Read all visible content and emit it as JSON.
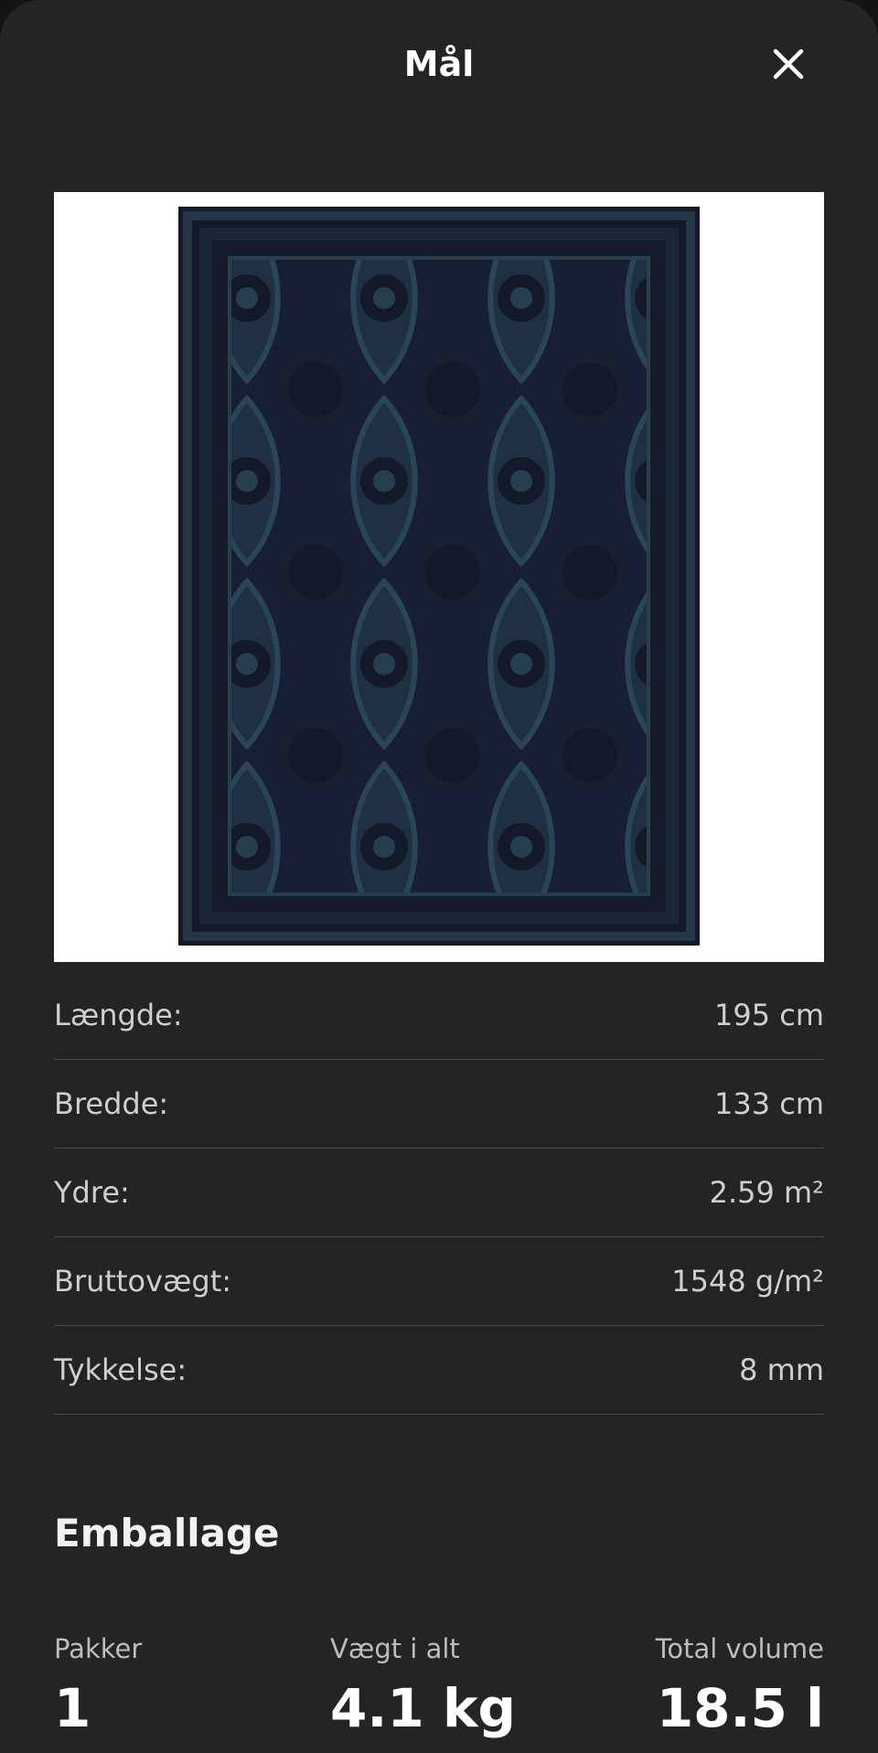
{
  "header": {
    "title": "Mål"
  },
  "product_image": {
    "icon": "rug-image",
    "colors": {
      "background": "#ffffff",
      "rug_base": "#1a2236",
      "rug_pattern": "#2b4a5a"
    }
  },
  "dimensions": [
    {
      "label": "Længde:",
      "value": "195 cm"
    },
    {
      "label": "Bredde:",
      "value": "133 cm"
    },
    {
      "label": "Ydre:",
      "value": "2.59 m²"
    },
    {
      "label": "Bruttovægt:",
      "value": "1548 g/m²"
    },
    {
      "label": "Tykkelse:",
      "value": "8 mm"
    }
  ],
  "packaging": {
    "title": "Emballage",
    "stats": [
      {
        "label": "Pakker",
        "value": "1"
      },
      {
        "label": "Vægt i alt",
        "value": "4.1 kg"
      },
      {
        "label": "Total volume",
        "value": "18.5 l"
      }
    ]
  }
}
